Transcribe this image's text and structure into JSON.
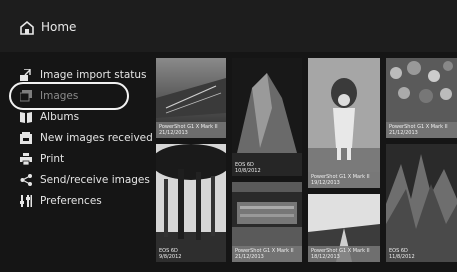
{
  "header": {
    "title": "Home",
    "icon": "home-icon"
  },
  "menu": [
    {
      "label": "Image import status",
      "icon": "import-icon"
    },
    {
      "label": "Images",
      "icon": "images-icon",
      "selected": true
    },
    {
      "label": "Albums",
      "icon": "albums-icon"
    },
    {
      "label": "New images received",
      "icon": "new-images-icon"
    },
    {
      "label": "Print",
      "icon": "printer-icon"
    },
    {
      "label": "Send/receive images",
      "icon": "share-icon"
    },
    {
      "label": "Preferences",
      "icon": "preferences-icon"
    }
  ],
  "thumbnails": [
    {
      "model": "PowerShot G1 X Mark II",
      "date": "21/12/2013"
    },
    {
      "model": "EOS 6D",
      "date": "10/8/2012"
    },
    {
      "model": "PowerShot G1 X Mark II",
      "date": "19/12/2013"
    },
    {
      "model": "PowerShot G1 X Mark II",
      "date": "21/12/2013"
    },
    {
      "model": "EOS 6D",
      "date": "9/8/2012"
    },
    {
      "model": "PowerShot G1 X Mark II",
      "date": "21/12/2013"
    },
    {
      "model": "PowerShot G1 X Mark II",
      "date": "18/12/2013"
    },
    {
      "model": "EOS 6D",
      "date": "11/8/2012"
    }
  ]
}
